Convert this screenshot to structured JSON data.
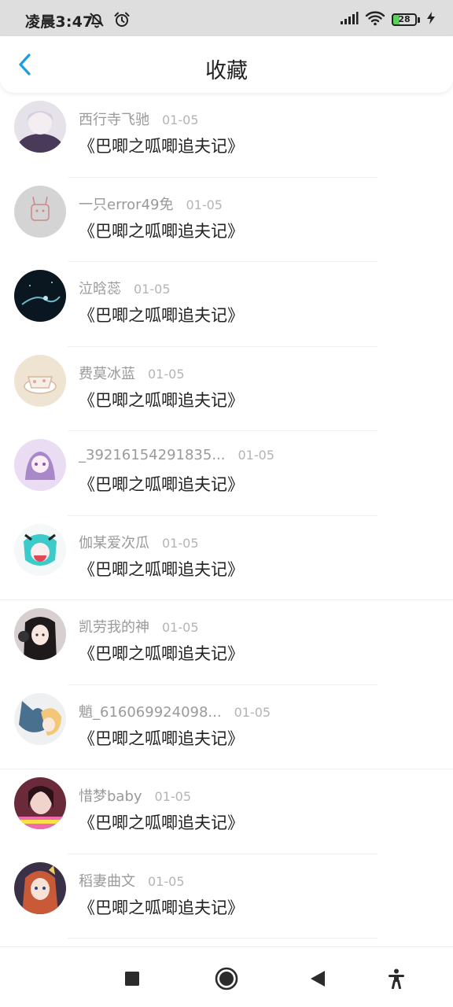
{
  "status_bar": {
    "time": "凌晨3:47",
    "battery_level": "28",
    "icons": [
      "alarm-off-icon",
      "alarm-clock-icon",
      "signal-icon",
      "wifi-icon",
      "battery-icon",
      "charging-icon"
    ]
  },
  "header": {
    "title": "收藏",
    "back_icon": "back-chevron-icon"
  },
  "favorites": [
    {
      "user": "西行寺飞驰",
      "date": "01-05",
      "title": "《巴唧之呱唧追夫记》",
      "avatar_hue": "#6a5a7a"
    },
    {
      "user": "一只error49免",
      "date": "01-05",
      "title": "《巴唧之呱唧追夫记》",
      "avatar_hue": "#cfcfcf"
    },
    {
      "user": "泣晗蕊",
      "date": "01-05",
      "title": "《巴唧之呱唧追夫记》",
      "avatar_hue": "#102030"
    },
    {
      "user": "费莫冰蓝",
      "date": "01-05",
      "title": "《巴唧之呱唧追夫记》",
      "avatar_hue": "#e8dcc8"
    },
    {
      "user": "_39216154291835...",
      "date": "01-05",
      "title": "《巴唧之呱唧追夫记》",
      "avatar_hue": "#dcc8e8"
    },
    {
      "user": "伽某爱次瓜",
      "date": "01-05",
      "title": "《巴唧之呱唧追夫记》",
      "avatar_hue": "#3cc8c8"
    },
    {
      "user": "凯劳我的神",
      "date": "01-05",
      "title": "《巴唧之呱唧追夫记》",
      "avatar_hue": "#2a2a2a"
    },
    {
      "user": "魈_616069924098...",
      "date": "01-05",
      "title": "《巴唧之呱唧追夫记》",
      "avatar_hue": "#4a7090"
    },
    {
      "user": "惜梦baby",
      "date": "01-05",
      "title": "《巴唧之呱唧追夫记》",
      "avatar_hue": "#8a4a5a"
    },
    {
      "user": "稻妻曲文",
      "date": "01-05",
      "title": "《巴唧之呱唧追夫记》",
      "avatar_hue": "#c06040"
    }
  ],
  "nav_bar": {
    "icons": [
      "recents-square-icon",
      "home-circle-icon",
      "back-triangle-icon",
      "accessibility-icon"
    ]
  },
  "colors": {
    "accent": "#1e9be6",
    "status_bar_bg": "#dedede",
    "username": "#9a9a9a",
    "date": "#b4b4b4",
    "title": "#222222"
  }
}
